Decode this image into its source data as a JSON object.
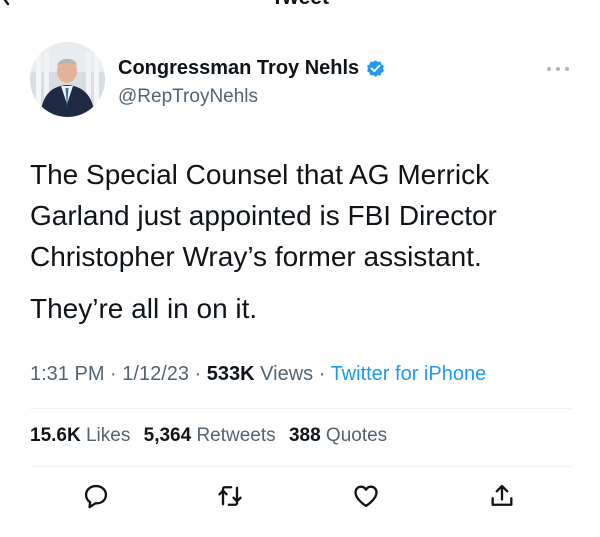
{
  "header": {
    "title": "Tweet",
    "back_icon": "back-arrow-icon"
  },
  "author": {
    "name": "Congressman Troy Nehls",
    "handle": "@RepTroyNehls",
    "verified": true,
    "verified_color": "#1d9bf0"
  },
  "tweet": {
    "paragraphs": [
      "The Special Counsel that AG Merrick Garland just appointed is FBI Director Christopher Wray’s former assistant.",
      "They’re all in on it."
    ]
  },
  "meta": {
    "time": "1:31 PM",
    "sep1": " · ",
    "date": "1/12/23",
    "sep2": " · ",
    "views_count": "533K",
    "views_label": " Views",
    "sep3": " · ",
    "source": "Twitter for iPhone"
  },
  "stats": {
    "likes_count": "15.6K",
    "likes_label": " Likes",
    "retweets_count": "5,364",
    "retweets_label": " Retweets",
    "quotes_count": "388",
    "quotes_label": " Quotes"
  },
  "actions": {
    "icons": [
      "reply-icon",
      "retweet-icon",
      "like-icon",
      "share-icon"
    ]
  },
  "colors": {
    "text": "#0f1419",
    "secondary": "#536471",
    "link": "#1d9bf0",
    "divider": "#eff3f4"
  }
}
